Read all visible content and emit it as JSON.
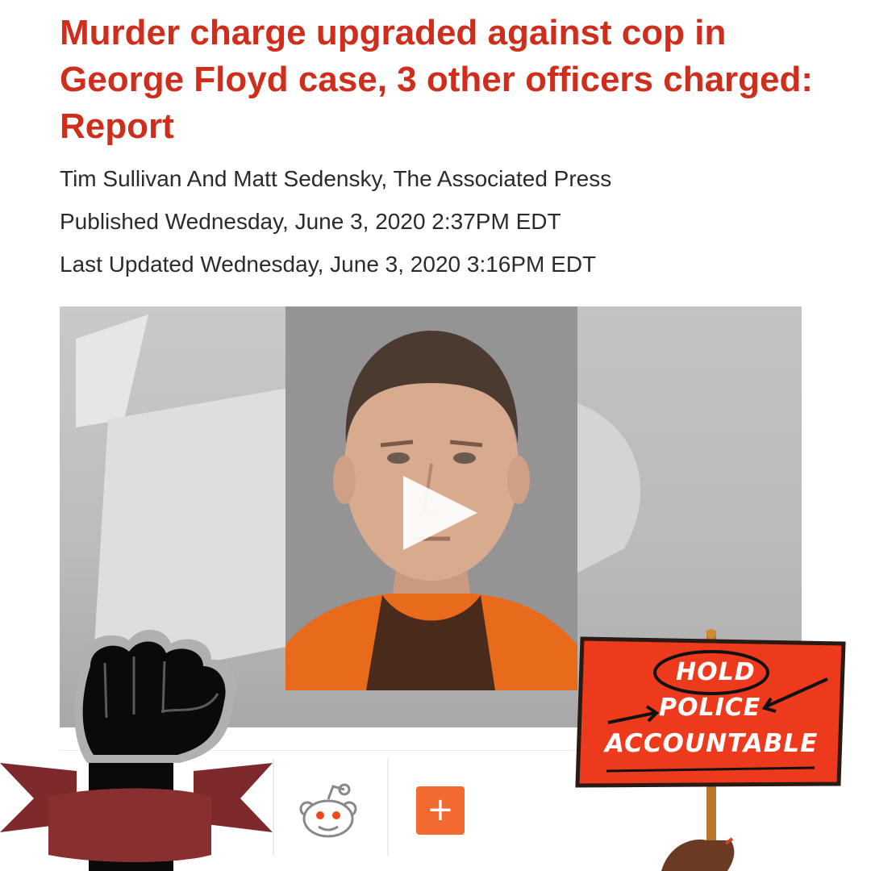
{
  "article": {
    "headline": "Murder charge upgraded against cop in George Floyd case, 3 other officers charged: Report",
    "byline": "Tim Sullivan And Matt Sedensky, The Associated Press",
    "published": "Published Wednesday, June 3, 2020 2:37PM EDT",
    "updated": "Last Updated Wednesday, June 3, 2020 3:16PM EDT"
  },
  "video": {
    "play_icon": "play-icon",
    "thumbnail": "mugshot-photo"
  },
  "share_bar": {
    "reddit_icon": "reddit-icon",
    "plus_label": "+"
  },
  "stickers": {
    "fist": "raised-fist-icon",
    "sign": {
      "line1": "HOLD",
      "line2": "POLICE",
      "line3": "ACCOUNTABLE"
    }
  },
  "colors": {
    "headline": "#cf2e1c",
    "text": "#2b2b2b",
    "share_plus": "#f26a2f",
    "sign": "#ee3a1c",
    "ribbon": "#7e2a2c"
  }
}
